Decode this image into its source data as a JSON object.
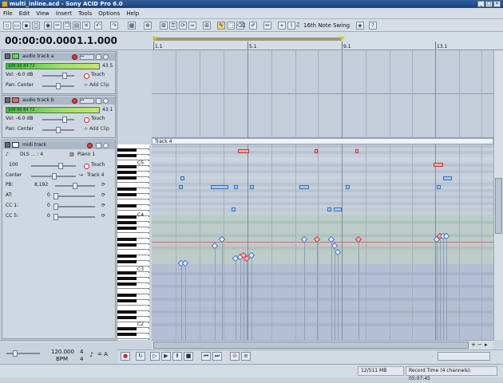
{
  "window": {
    "title": "multi_inline.acd - Sony ACID Pro 6.0"
  },
  "menu": [
    "File",
    "Edit",
    "View",
    "Insert",
    "Tools",
    "Options",
    "Help"
  ],
  "toolbar": {
    "swing": "16th Note Swing"
  },
  "time": {
    "position": "00:00:00.000",
    "measure": "1.1.000"
  },
  "ruler": {
    "labels": [
      "1.1",
      "5.1",
      "9.1",
      "13.1"
    ]
  },
  "tracks": [
    {
      "name": "audio track a",
      "meter_labels": "108  96  84  72",
      "peak": "43.5",
      "vol": "Vol: -6.0 dB",
      "mode": "Touch",
      "pan": "Pan:  Center",
      "addclip": "Add Clip"
    },
    {
      "name": "audio track b",
      "meter_labels": "108  96  84  72",
      "peak": "43.1",
      "vol": "Vol: -6.0 dB",
      "mode": "Touch",
      "pan": "Pan:  Center",
      "addclip": "Add Clip"
    }
  ],
  "midi": {
    "name": "midi track",
    "device": "DLS ... : 4",
    "instrument": "Piano 1",
    "volume": "100",
    "mode": "Touch",
    "pan": "Center",
    "route": "Track 4",
    "pb_label": "PB:",
    "pb_value": "8,192",
    "at_label": "AT:",
    "at_value": "0",
    "cc1_label": "CC 1:",
    "cc1_value": "0",
    "cc5_label": "CC 5:",
    "cc5_value": "0"
  },
  "pianoroll": {
    "header": "Track 4",
    "octaves": [
      "C5",
      "C4",
      "C3",
      "C2"
    ]
  },
  "tempo": {
    "bpm": "120.000",
    "bpm_label": "BPM",
    "sig_top": "4",
    "sig_bottom": "4",
    "key": "= A"
  },
  "status": {
    "memory": "12/511 MB",
    "record_time": "Record Time (4 channels): 05:07:45"
  }
}
